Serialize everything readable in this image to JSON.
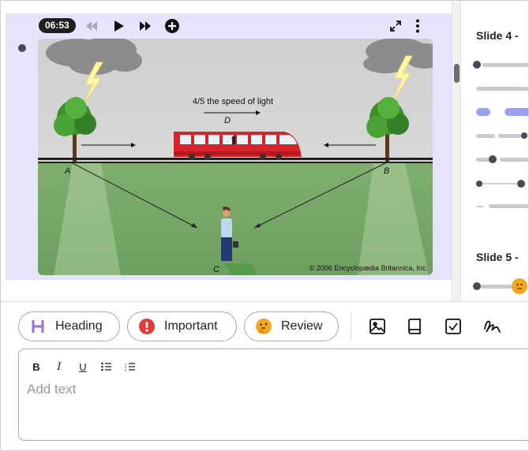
{
  "player": {
    "time": "06:53",
    "icons": [
      "rewind-icon",
      "play-icon",
      "fast-forward-icon",
      "add-circle-icon",
      "fullscreen-icon",
      "more-vertical-icon"
    ]
  },
  "video": {
    "caption_speed": "4/5 the speed of light",
    "label_d": "D",
    "label_a": "A",
    "label_b": "B",
    "label_c": "C",
    "copyright": "© 2006 Encyclopædia Britannica, Inc."
  },
  "slides": {
    "slide4_title": "Slide 4 -",
    "slide5_title": "Slide 5 -"
  },
  "tags": {
    "heading_label": "Heading",
    "important_label": "Important",
    "review_label": "Review"
  },
  "editor": {
    "placeholder": "Add text",
    "value": "",
    "format_bold": "B",
    "format_italic": "I",
    "format_underline": "U"
  },
  "colors": {
    "panel_bg": "#e6e4fb",
    "accent_purple": "#9b6ce0",
    "important_red": "#e23b3b",
    "review_orange": "#f5a623",
    "slide_highlight": "#9aa0ef"
  }
}
